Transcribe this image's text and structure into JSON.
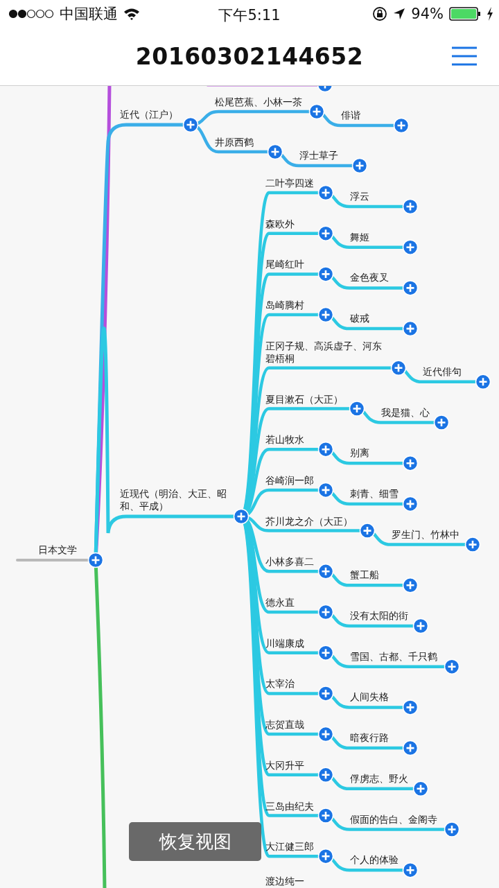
{
  "status_bar": {
    "carrier": "中国联通",
    "time": "下午5:11",
    "battery": "94%"
  },
  "header": {
    "title": "20160302144652"
  },
  "mindmap": {
    "root": {
      "label": "日本文学",
      "children": [
        {
          "label": "近代（江户）",
          "color": "#3aaee8",
          "children": [
            {
              "label": "松尾芭蕉、小林一茶",
              "children": [
                {
                  "label": "俳谐"
                }
              ]
            },
            {
              "label": "井原西鹤",
              "children": [
                {
                  "label": "浮士草子"
                }
              ]
            }
          ]
        },
        {
          "label": "近现代（明治、大正、昭和、平成）",
          "color": "#2cc9e2",
          "children": [
            {
              "label": "二叶亭四迷",
              "children": [
                {
                  "label": "浮云"
                }
              ]
            },
            {
              "label": "森欧外",
              "children": [
                {
                  "label": "舞姬"
                }
              ]
            },
            {
              "label": "尾崎红叶",
              "children": [
                {
                  "label": "金色夜叉"
                }
              ]
            },
            {
              "label": "岛崎腾村",
              "children": [
                {
                  "label": "破戒"
                }
              ]
            },
            {
              "label": "正冈子规、高浜虚子、河东碧梧桐",
              "children": [
                {
                  "label": "近代俳句"
                }
              ]
            },
            {
              "label": "夏目漱石（大正）",
              "children": [
                {
                  "label": "我是猫、心"
                }
              ]
            },
            {
              "label": "若山牧水",
              "children": [
                {
                  "label": "别离"
                }
              ]
            },
            {
              "label": "谷崎润一郎",
              "children": [
                {
                  "label": "刺青、细雪"
                }
              ]
            },
            {
              "label": "芥川龙之介（大正）",
              "children": [
                {
                  "label": "罗生门、竹林中"
                }
              ]
            },
            {
              "label": "小林多喜二",
              "children": [
                {
                  "label": "蟹工船"
                }
              ]
            },
            {
              "label": "德永直",
              "children": [
                {
                  "label": "没有太阳的街"
                }
              ]
            },
            {
              "label": "川端康成",
              "children": [
                {
                  "label": "雪国、古都、千只鹤"
                }
              ]
            },
            {
              "label": "太宰治",
              "children": [
                {
                  "label": "人间失格"
                }
              ]
            },
            {
              "label": "志贺直哉",
              "children": [
                {
                  "label": "暗夜行路"
                }
              ]
            },
            {
              "label": "大冈升平",
              "children": [
                {
                  "label": "俘虏志、野火"
                }
              ]
            },
            {
              "label": "三岛由纪夫",
              "children": [
                {
                  "label": "假面的告白、金阁寺"
                }
              ]
            },
            {
              "label": "大江健三郎",
              "children": [
                {
                  "label": "个人的体验"
                }
              ]
            },
            {
              "label": "渡边纯一"
            }
          ]
        }
      ]
    }
  },
  "toast": {
    "text": "恢复视图"
  }
}
